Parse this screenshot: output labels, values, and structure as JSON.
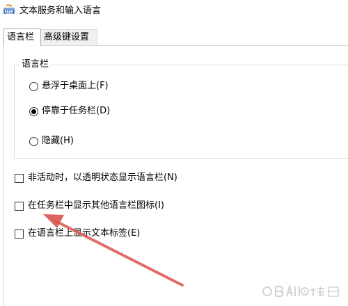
{
  "window": {
    "title": "文本服务和输入语言"
  },
  "tabs": [
    {
      "label": "语言栏",
      "active": true
    },
    {
      "label": "高级键设置",
      "active": false
    }
  ],
  "language_bar_group": {
    "label": "语言栏",
    "options": [
      {
        "label": "悬浮于桌面上(F)",
        "checked": false
      },
      {
        "label": "停靠于任务栏(D)",
        "checked": true
      },
      {
        "label": "隐藏(H)",
        "checked": false
      }
    ]
  },
  "checkboxes": [
    {
      "label": "非活动时，以透明状态显示语言栏(N)",
      "checked": false
    },
    {
      "label": "在任务栏中显示其他语言栏图标(I)",
      "checked": false
    },
    {
      "label": "在语言栏上显示文本标签(E)",
      "checked": false
    }
  ],
  "colors": {
    "annotation_arrow": "#d9534f"
  },
  "icons": {
    "title": "keyboard-language-icon",
    "annotation": "arrow-annotation-icon",
    "watermark": "baidu-watermark-icon"
  }
}
